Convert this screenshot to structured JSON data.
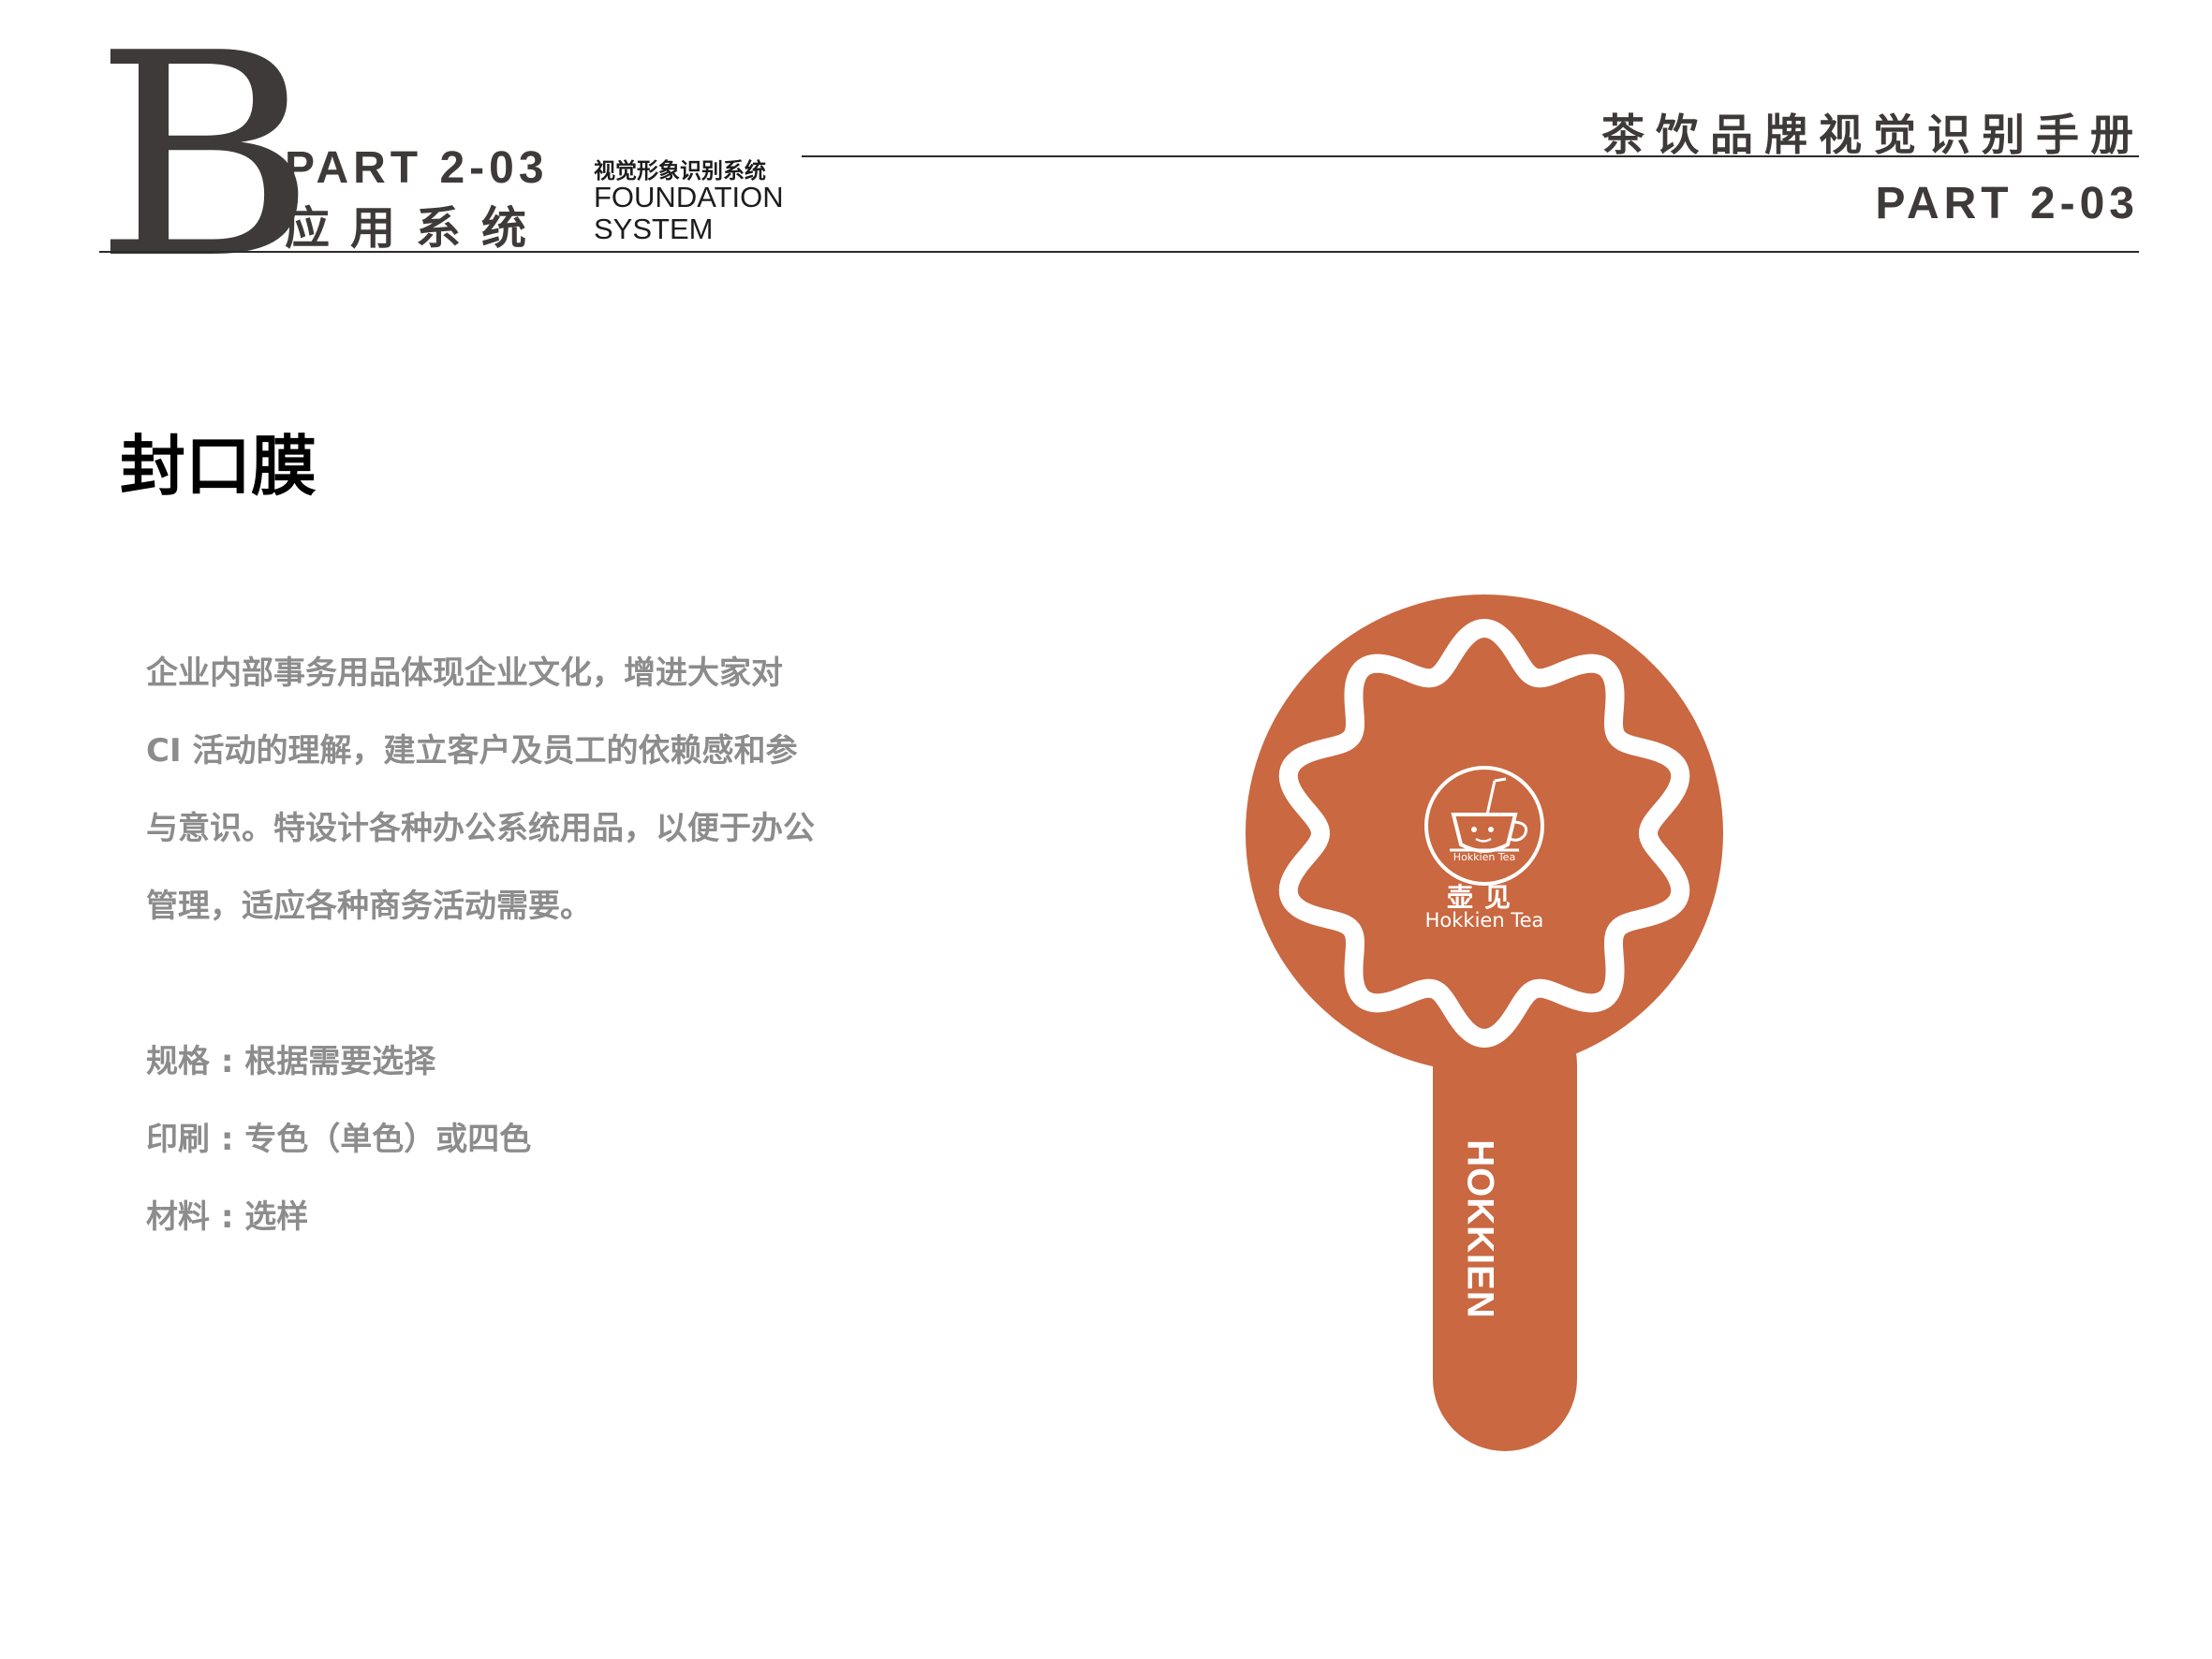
{
  "header": {
    "big_letter": "B",
    "part_code": "PART 2-03",
    "section_group": "应用系统",
    "subtitle_cn": "视觉形象识别系统",
    "subtitle_en_line1": "FOUNDATION",
    "subtitle_en_line2": "SYSTEM",
    "manual_title": "茶饮品牌视觉识别手册",
    "part_code_right": "PART 2-03"
  },
  "section": {
    "title": "封口膜",
    "description_lines": [
      "企业内部事务用品体现企业文化，增进大家对",
      "CI 活动的理解，建立客户及员工的依赖感和参",
      "与意识。特设计各种办公系统用品，以便于办公",
      "管理，适应各种商务活动需要。"
    ],
    "specs": {
      "size": "规格 : 根据需要选择",
      "printing": "印刷 : 专色（单色）或四色",
      "material": "材料 : 选样"
    }
  },
  "illustration": {
    "logo_small_text": "Hokkien Tea",
    "logo_cn": "壶见",
    "logo_en": "Hokkien Tea",
    "handle_text": "HOKKIEN",
    "icons": [
      "teacup-logo-icon",
      "wavy-seal-border-icon"
    ]
  },
  "colors": {
    "brand": "#c96841",
    "text_dark": "#3e3a39",
    "text_gray": "#8c8c8c"
  }
}
